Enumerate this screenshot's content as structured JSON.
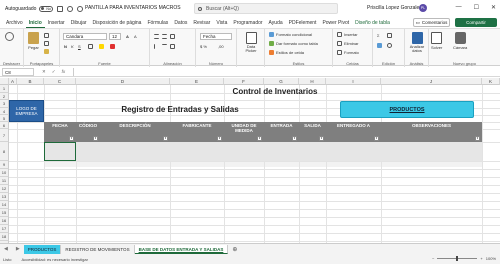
{
  "titlebar": {
    "autosave": "Autoguardado",
    "autosave_state": "No",
    "filename": "PANTILLA PARA INVENTARIOS MACROS",
    "search_placeholder": "Buscar (Alt+Q)",
    "user": "Priscilla Lopez Gonzalez",
    "user_initials": "PL"
  },
  "tabs": [
    "Archivo",
    "Inicio",
    "Insertar",
    "Dibujar",
    "Disposición de página",
    "Fórmulas",
    "Datos",
    "Revisar",
    "Vista",
    "Programador",
    "Ayuda",
    "PDFelement",
    "Power Pivot",
    "Diseño de tabla"
  ],
  "active_tab": "Inicio",
  "buttons": {
    "comments": "Comentarios",
    "share": "Compartir"
  },
  "ribbon": {
    "paste": "Pegar",
    "font": "Candara",
    "font_size": "12",
    "number_format": "Fecha",
    "table_format": "Dar formato como tabla",
    "cond_format": "Formato condicional",
    "cell_styles": "Estilos de celda",
    "insert": "Insertar",
    "delete": "Eliminar",
    "format": "Formato",
    "data_picker": "Data Picker",
    "analyze": "Analizar datos",
    "solve": "Solver",
    "camera": "Cámara",
    "groups": [
      "Deshacer",
      "Portapapeles",
      "Fuente",
      "Alineación",
      "Número",
      "Estilos",
      "Celdas",
      "Edición",
      "Análisis",
      "Nuevo grupo"
    ]
  },
  "formula_bar": {
    "namebox": "C8",
    "fx": "fx"
  },
  "columns": [
    "A",
    "B",
    "C",
    "D",
    "E",
    "F",
    "G",
    "H",
    "I",
    "J",
    "K"
  ],
  "rows": [
    "1",
    "2",
    "3",
    "4",
    "5",
    "6",
    "7",
    "8",
    "9",
    "10",
    "11",
    "12",
    "13",
    "14",
    "15",
    "16",
    "17",
    "18",
    "19",
    "20"
  ],
  "sheet": {
    "logo": "LOGO DE EMPRESA",
    "title": "Control de Inventarios",
    "subtitle": "Registro de Entradas y Salidas",
    "products_button": "PRODUCTOS",
    "headers": [
      "FECHA",
      "CÓDIGO",
      "DESCRIPCIÓN",
      "FABRICANTE",
      "UNIDAD DE MEDIDA",
      "ENTRADA",
      "SALIDA",
      "ENTREGADO A",
      "OBSERVACIONES"
    ]
  },
  "sheet_tabs": [
    "PRODUCTOS",
    "REGISTRO DE MOVIMIENTOS",
    "BASE DE DATOS ENTRADA Y SALIDAS"
  ],
  "status": {
    "ready": "Listo",
    "accessibility": "Accesibilidad: es necesario investigar",
    "zoom": "100%"
  }
}
